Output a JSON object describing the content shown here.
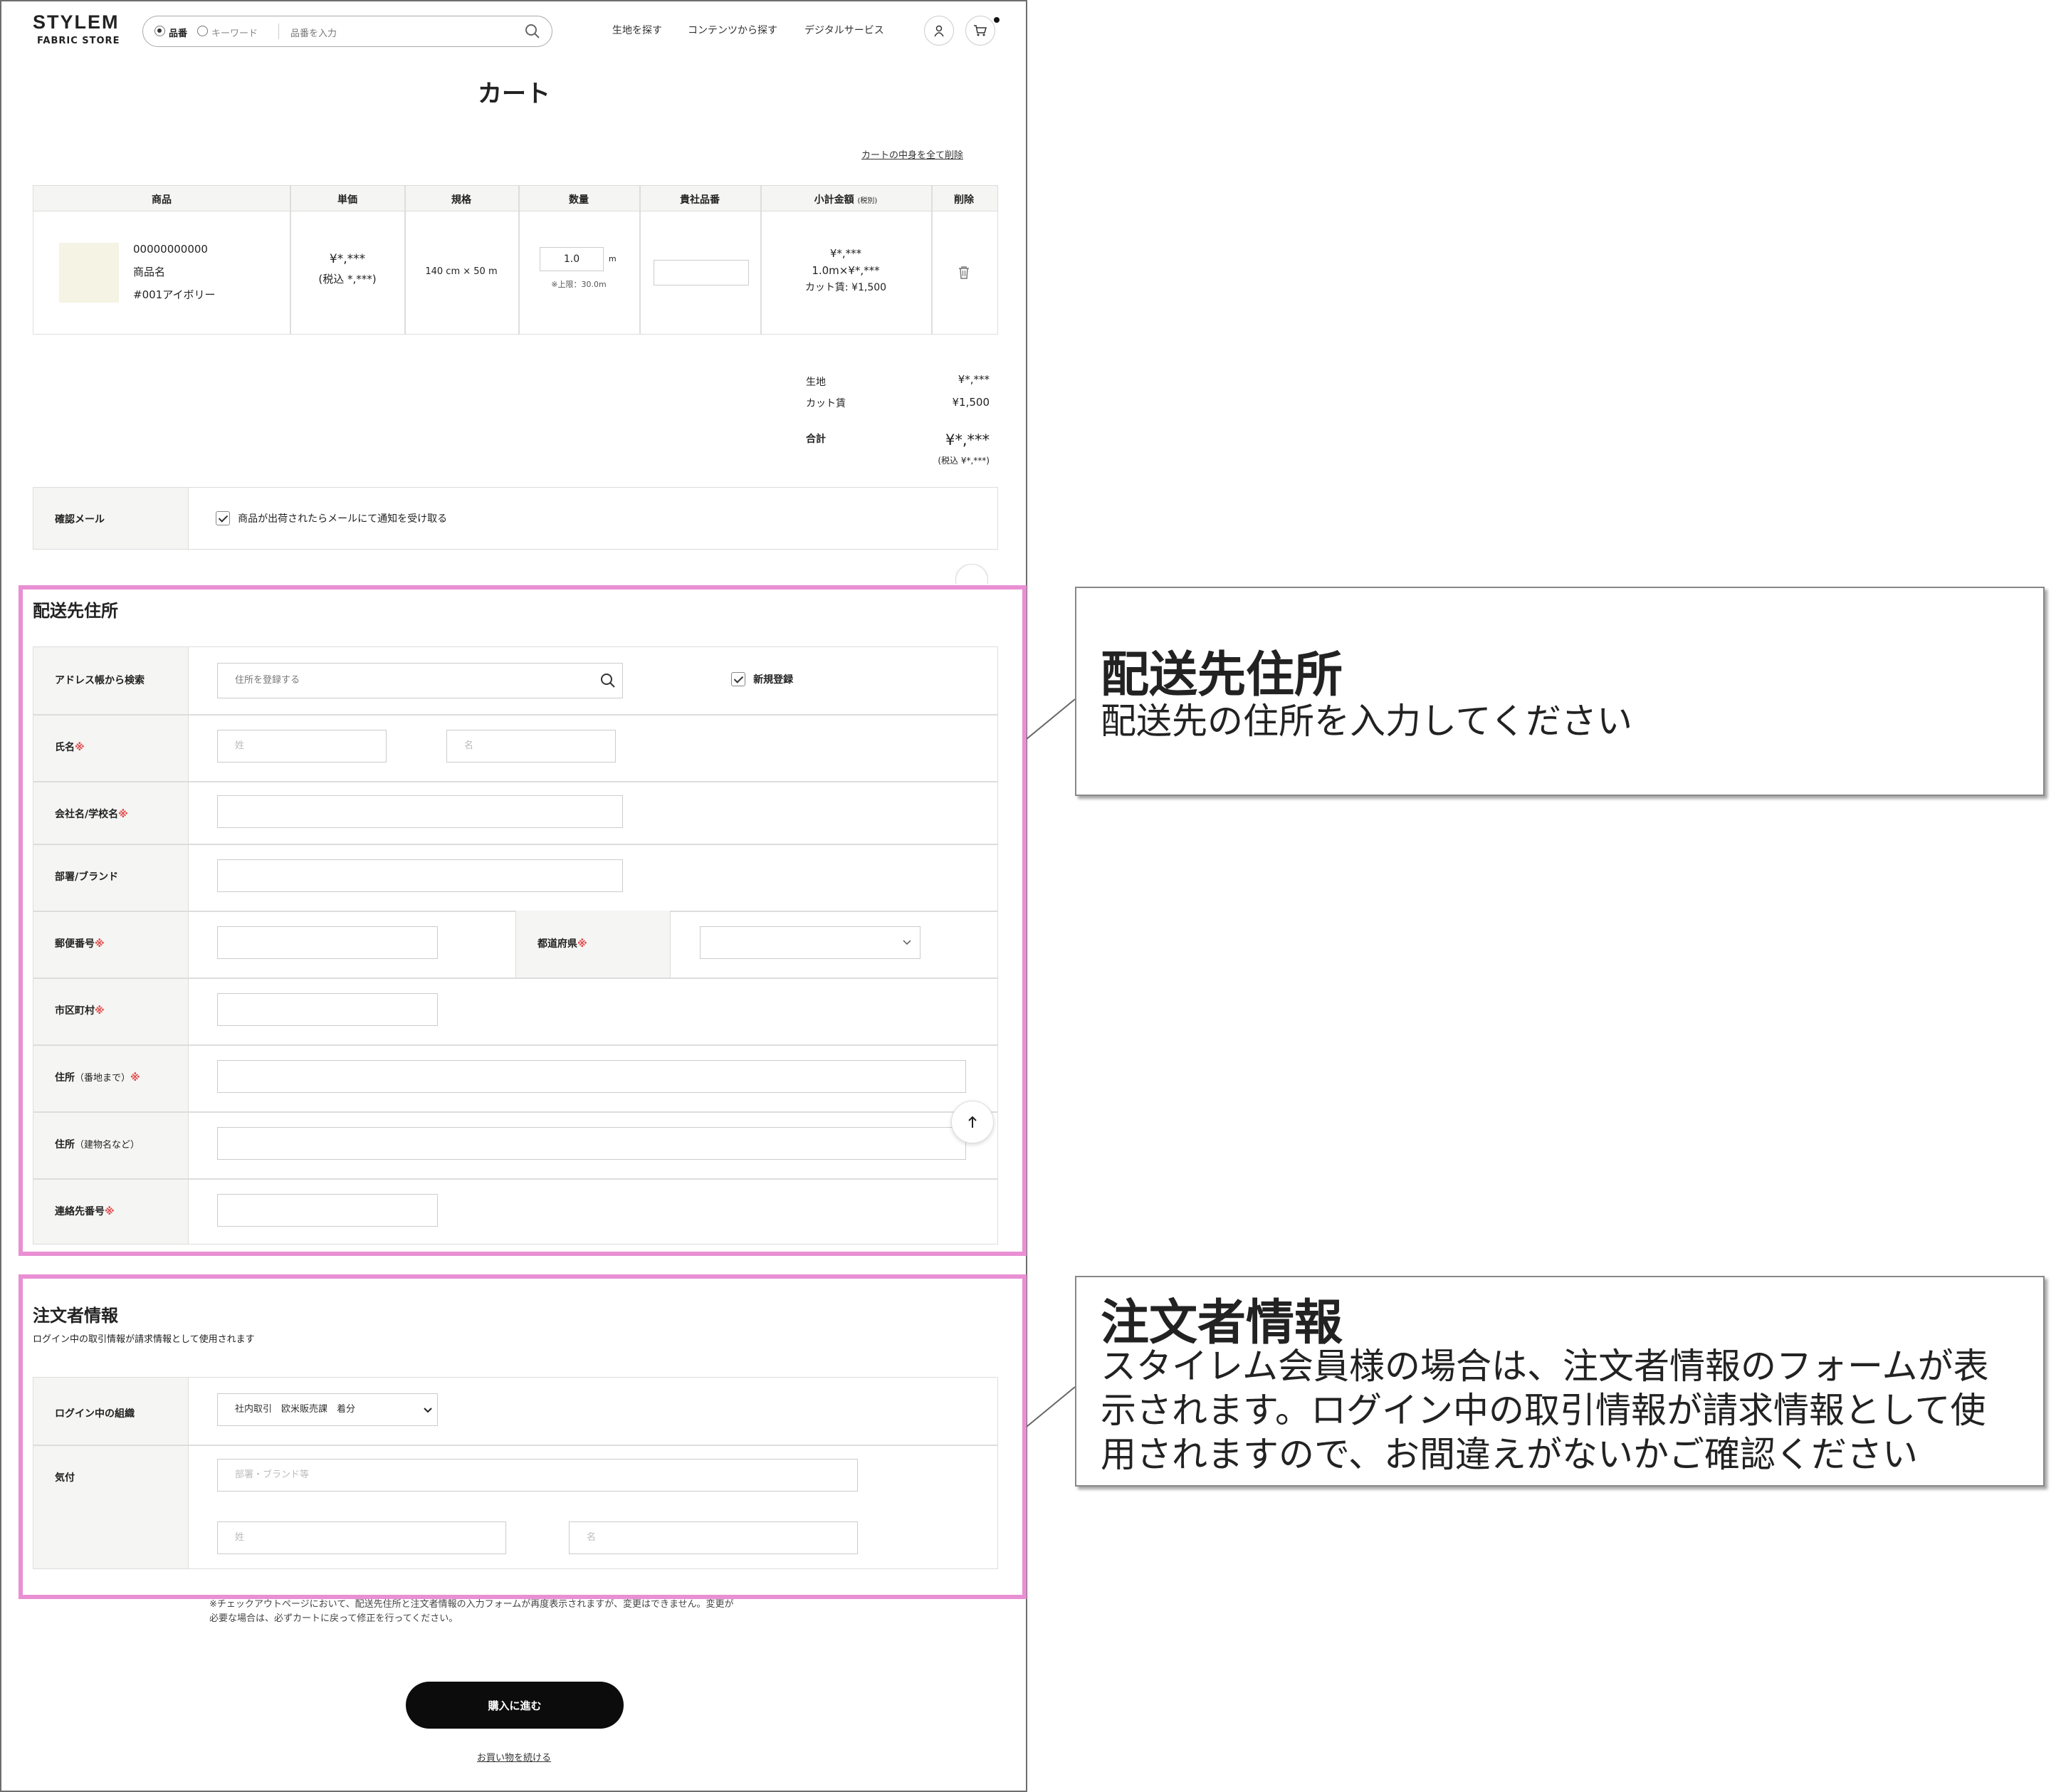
{
  "header": {
    "logo_main": "STYLEM",
    "logo_sub": "FABRIC STORE",
    "search": {
      "radio_1": "品番",
      "radio_2": "キーワード",
      "placeholder": "品番を入力"
    },
    "nav": [
      "生地を探す",
      "コンテンツから探す",
      "デジタルサービス"
    ]
  },
  "page_title": "カート",
  "clear_cart_link": "カートの中身を全て削除",
  "cart_table": {
    "headers": {
      "product": "商品",
      "unit_price": "単価",
      "spec": "規格",
      "quantity": "数量",
      "your_ref": "貴社品番",
      "subtotal": "小計金額",
      "subtotal_note": "(税別)",
      "delete": "削除"
    },
    "row": {
      "code": "00000000000",
      "name": "商品名",
      "color": "#001アイボリー",
      "price": "¥*,***",
      "price_tax": "(税込 *,***)",
      "spec": "140 cm × 50 m",
      "qty": "1.0",
      "qty_unit": "m",
      "qty_limit": "※上限：30.0m",
      "subtotal_1": "¥*,***",
      "subtotal_2": "1.0m×¥*,***",
      "subtotal_3": "カット賃: ¥1,500"
    }
  },
  "totals": {
    "fabric_label": "生地",
    "fabric_value": "¥*,***",
    "cut_label": "カット賃",
    "cut_value": "¥1,500",
    "total_label": "合計",
    "total_value": "¥*,***",
    "total_tax": "(税込 ¥*,***)"
  },
  "confirm_mail": {
    "label": "確認メール",
    "checkbox_label": "商品が出荷されたらメールにて通知を受け取る"
  },
  "shipping": {
    "heading": "配送先住所",
    "address_book_label": "アドレス帳から検索",
    "address_book_placeholder": "住所を登録する",
    "new_register": "新規登録",
    "name_label": "氏名",
    "last_name_ph": "姓",
    "first_name_ph": "名",
    "company_label": "会社名/学校名",
    "dept_label": "部署/ブランド",
    "zip_label": "郵便番号",
    "pref_label": "都道府県",
    "city_label": "市区町村",
    "addr1_label": "住所",
    "addr1_note": "（番地まで）",
    "addr2_label": "住所",
    "addr2_note": "（建物名など）",
    "phone_label": "連絡先番号",
    "req_mark": "※"
  },
  "orderer": {
    "heading": "注文者情報",
    "subtext": "ログイン中の取引情報が請求情報として使用されます",
    "org_label": "ログイン中の組織",
    "org_value": "社内取引　欧米販売課　着分",
    "attn_label": "気付",
    "attn_placeholder": "部署・ブランド等",
    "last_name_ph": "姓",
    "first_name_ph": "名"
  },
  "notes": {
    "line1": "※チェックアウトページにおいて、配送先住所と注文者情報の入力フォームが再度表示されますが、変更はできません。変更が",
    "line2": "必要な場合は、必ずカートに戻って修正を行ってください。"
  },
  "buttons": {
    "proceed": "購入に進む",
    "continue_shopping": "お買い物を続ける"
  },
  "callouts": [
    {
      "title": "配送先住所",
      "body": [
        "配送先の住所を入力してください"
      ]
    },
    {
      "title": "注文者情報",
      "body": [
        "スタイレム会員様の場合は、注文者情報のフォームが表",
        "示されます。ログイン中の取引情報が請求情報として使",
        "用されますので、お間違えがないかご確認ください"
      ]
    }
  ],
  "colors": {
    "highlight_border": "#e98fd3",
    "required": "#e14b4b",
    "button_bg": "#0c0c0c"
  }
}
